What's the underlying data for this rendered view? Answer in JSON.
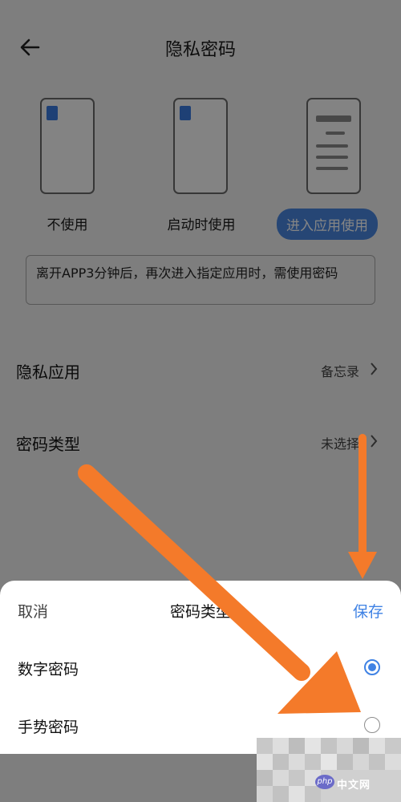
{
  "header": {
    "title": "隐私密码",
    "back_icon": "back-arrow-icon"
  },
  "modes": [
    {
      "label": "不使用",
      "selected": false
    },
    {
      "label": "启动时使用",
      "selected": false
    },
    {
      "label": "进入应用使用",
      "selected": true
    }
  ],
  "hint": "离开APP3分钟后，再次进入指定应用时，需使用密码",
  "settings": {
    "private_app": {
      "label": "隐私应用",
      "value": "备忘录"
    },
    "password_type": {
      "label": "密码类型",
      "value": "未选择"
    }
  },
  "sheet": {
    "cancel": "取消",
    "title": "密码类型",
    "save": "保存",
    "options": [
      {
        "label": "数字密码",
        "checked": true
      },
      {
        "label": "手势密码",
        "checked": false
      }
    ]
  },
  "watermark": {
    "text": "中文网",
    "badge": "php"
  },
  "colors": {
    "accent": "#3f82e4",
    "arrow": "#f47a2a",
    "overlay": "rgba(0,0,0,0.48)"
  }
}
